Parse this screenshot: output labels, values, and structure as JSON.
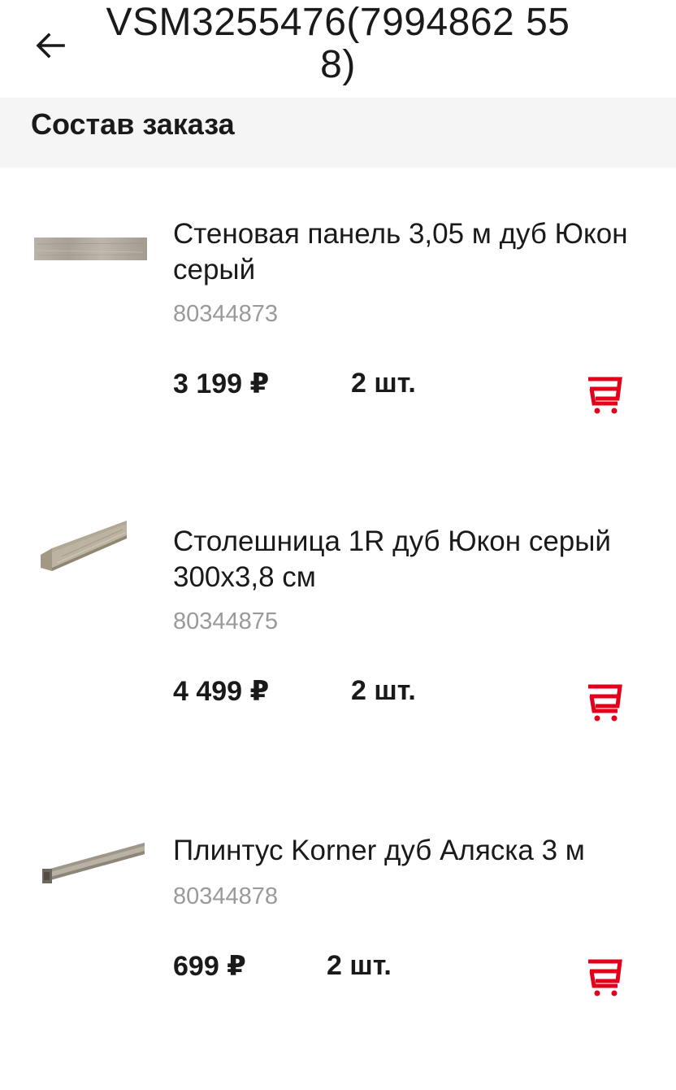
{
  "header": {
    "back_icon": "arrow-left-icon",
    "title": "VSM3255476(7994862 558)"
  },
  "section": {
    "title": "Состав заказа"
  },
  "colors": {
    "accent": "#e3001b",
    "section_bg": "#f5f5f5",
    "sku_text": "#9a9a9a"
  },
  "items": [
    {
      "name": "Стеновая панель 3,05 м дуб Юкон серый",
      "sku": "80344873",
      "price": "3 199 ₽",
      "qty": "2 шт.",
      "image": "wall-panel-image",
      "cart_icon": "cart-icon"
    },
    {
      "name": "Столешница 1R дуб Юкон серый 300x3,8 см",
      "sku": "80344875",
      "price": "4 499 ₽",
      "qty": "2 шт.",
      "image": "countertop-image",
      "cart_icon": "cart-icon"
    },
    {
      "name": "Плинтус Korner дуб Аляска 3 м",
      "sku": "80344878",
      "price": "699 ₽",
      "qty": "2 шт.",
      "image": "skirting-board-image",
      "cart_icon": "cart-icon"
    }
  ]
}
